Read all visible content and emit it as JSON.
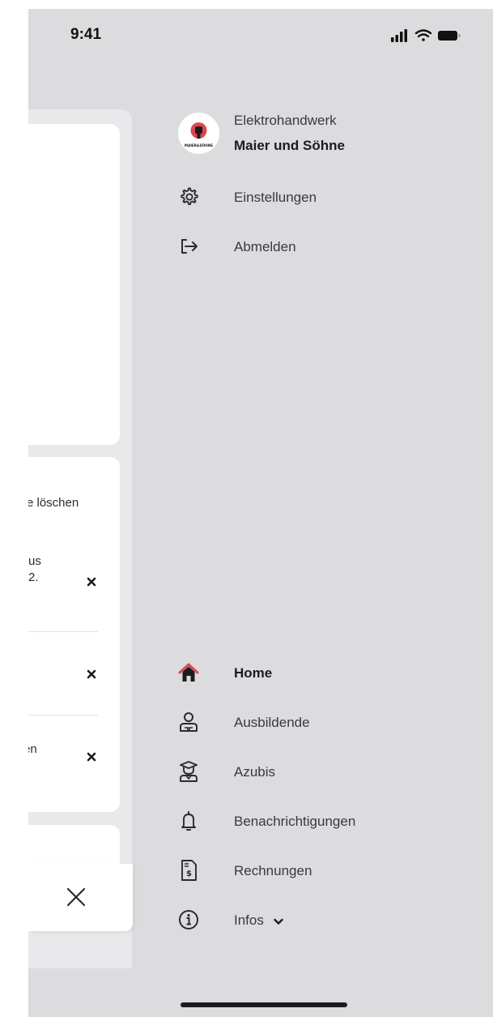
{
  "status_bar": {
    "time": "9:41"
  },
  "background_screen": {
    "card2": {
      "text_a": "e löschen",
      "text_b_line1": "us",
      "text_b_line2": "2.",
      "text_c": "en",
      "remove_icon": "close-icon"
    },
    "close_icon": "close-icon"
  },
  "drawer": {
    "brand": {
      "logo_text": "MAIER&SÖHNE",
      "line1": "Elektrohandwerk",
      "line2": "Maier und Söhne"
    },
    "top_items": [
      {
        "label": "Einstellungen",
        "icon": "gear-icon"
      },
      {
        "label": "Abmelden",
        "icon": "logout-icon"
      }
    ],
    "nav_items": [
      {
        "label": "Home",
        "icon": "home-icon",
        "active": true
      },
      {
        "label": "Ausbildende",
        "icon": "trainer-icon"
      },
      {
        "label": "Azubis",
        "icon": "graduate-icon"
      },
      {
        "label": "Benachrichtigungen",
        "icon": "bell-icon"
      },
      {
        "label": "Rechnungen",
        "icon": "invoice-icon"
      },
      {
        "label": "Infos",
        "icon": "info-icon",
        "suffix_icon": "chevron-down-icon"
      }
    ]
  },
  "colors": {
    "accent": "#e0474c",
    "drawer_bg": "#dcdcde",
    "text": "#3a3a3c"
  }
}
